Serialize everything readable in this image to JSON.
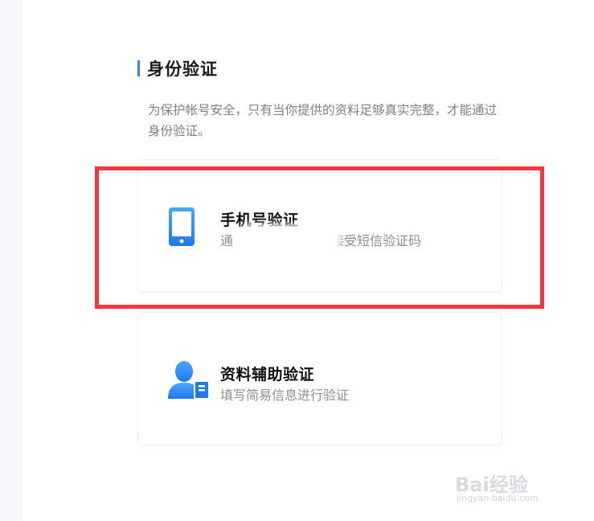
{
  "page": {
    "title": "身份验证",
    "description": "为保护帐号安全，只有当你提供的资料足够真实完整，才能通过身份验证。"
  },
  "options": [
    {
      "title": "手机号验证",
      "subtitle_prefix": "通",
      "subtitle_suffix": "接受短信验证码",
      "icon": "phone-icon"
    },
    {
      "title": "资料辅助验证",
      "subtitle": "填写简易信息进行验证",
      "icon": "user-card-icon"
    }
  ],
  "watermark": {
    "text": "Bai经验",
    "url": "jingyan.baidu.com"
  },
  "colors": {
    "accent": "#2f86f6",
    "highlight": "#f0383d"
  }
}
